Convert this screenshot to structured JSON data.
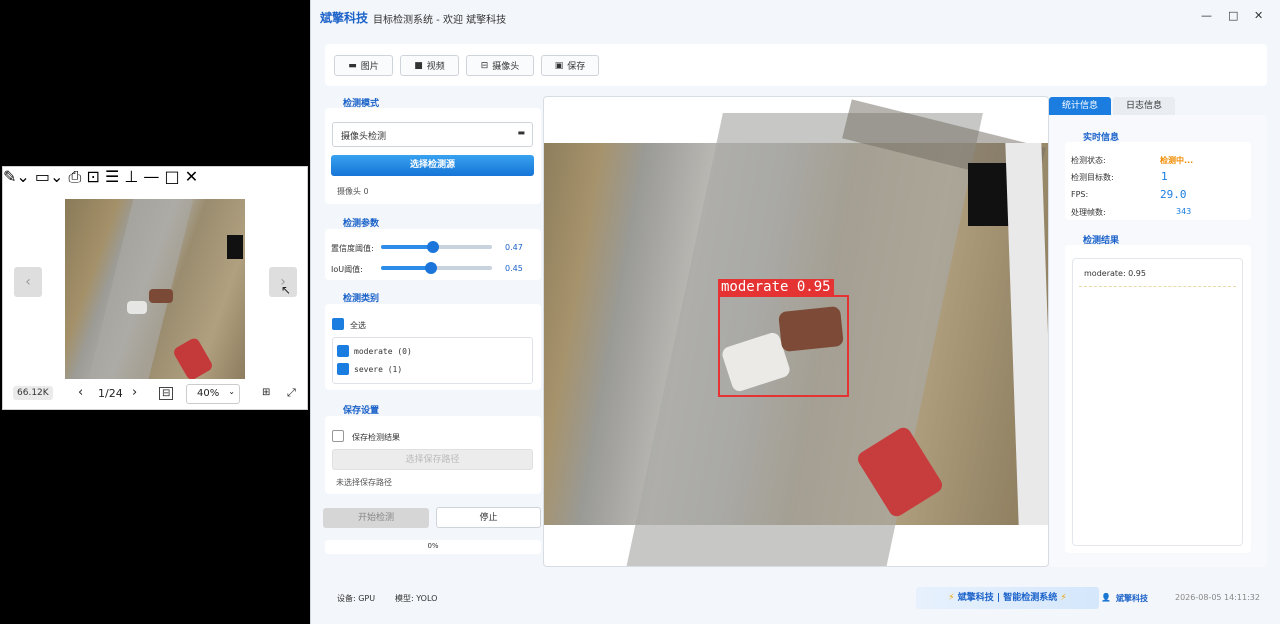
{
  "viewer": {
    "size_badge": "66.12K",
    "page_indicator": "1/24",
    "zoom": "40%"
  },
  "app": {
    "brand": "斌擎科技",
    "window_title": "目标检测系统 - 欢迎 斌擎科技",
    "toolbar": {
      "image_label": "图片",
      "video_label": "视频",
      "camera_label": "摄像头",
      "save_label": "保存"
    },
    "detect_mode": {
      "title": "检测模式",
      "selected_mode": "摄像头检测",
      "select_button": "选择检测源",
      "source_info": "摄像头 0"
    },
    "params": {
      "title": "检测参数",
      "conf_label": "置信度阈值:",
      "conf_value": "0.47",
      "conf_level": 0.47,
      "iou_label": "IoU阈值:",
      "iou_value": "0.45",
      "iou_level": 0.45
    },
    "classes": {
      "title": "检测类别",
      "select_all": "全选",
      "items": [
        "moderate (0)",
        "severe (1)"
      ]
    },
    "save_settings": {
      "title": "保存设置",
      "save_results": "保存检测结果",
      "choose_path": "选择保存路径",
      "path_status": "未选择保存路径"
    },
    "actions": {
      "start": "开始检测",
      "stop": "停止",
      "progress": "0%",
      "progress_level": 0
    },
    "detection": {
      "label": "moderate 0.95"
    },
    "tabs": {
      "stats": "统计信息",
      "log": "日志信息"
    },
    "realtime": {
      "title": "实时信息",
      "status_label": "检测状态:",
      "status_value": "检测中...",
      "targets_label": "检测目标数:",
      "targets_value": "1",
      "fps_label": "FPS:",
      "fps_value": "29.0",
      "frames_label": "处理帧数:",
      "frames_value": "343"
    },
    "results": {
      "title": "检测结果",
      "items": [
        "moderate: 0.95"
      ]
    },
    "footer": {
      "device": "设备: GPU",
      "model": "模型: YOLO",
      "slogan": "斌擎科技 | 智能检测系统",
      "user": "斌擎科技",
      "datetime": "2026-08-05 14:11:32"
    },
    "colors": {
      "accent": "#1b62c9",
      "status": "#f08c00",
      "box": "#e53232"
    }
  }
}
